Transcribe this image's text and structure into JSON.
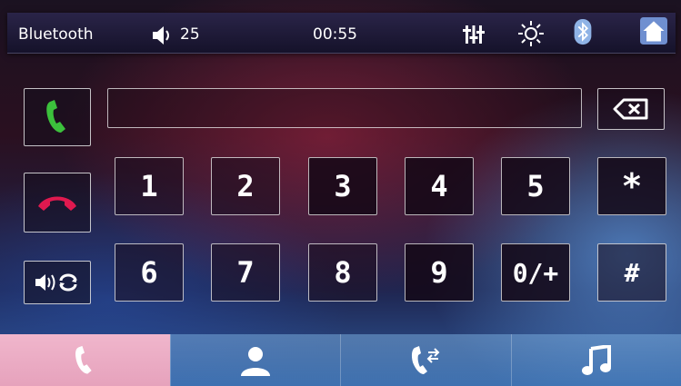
{
  "status": {
    "app_title": "Bluetooth",
    "volume": "25",
    "time": "00:55",
    "icons": [
      "speaker-icon",
      "equalizer-icon",
      "brightness-icon",
      "bluetooth-icon",
      "home-icon"
    ]
  },
  "dialer": {
    "number": "",
    "keys_row1": [
      "1",
      "2",
      "3",
      "4",
      "5",
      "*"
    ],
    "keys_row2": [
      "6",
      "7",
      "8",
      "9",
      "0/+",
      "#"
    ]
  },
  "side_buttons": [
    "call-icon",
    "hangup-icon",
    "audio-transfer-icon"
  ],
  "tabs": [
    "dialpad-tab",
    "contacts-tab",
    "call-log-tab",
    "music-tab"
  ],
  "colors": {
    "call": "#3cc03c",
    "hangup": "#e0194f",
    "active_tab": "#f0b6cc"
  }
}
